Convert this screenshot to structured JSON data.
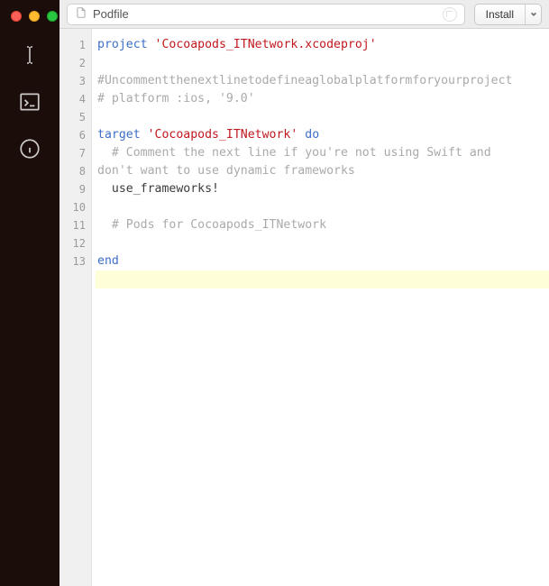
{
  "window": {
    "traffic_lights": [
      "close",
      "minimize",
      "maximize"
    ]
  },
  "sidebar": {
    "items": [
      {
        "id": "cursor-icon",
        "label": "Text Cursor"
      },
      {
        "id": "terminal-icon",
        "label": "Console"
      },
      {
        "id": "info-icon",
        "label": "Info"
      }
    ]
  },
  "toolbar": {
    "file_label": "Podfile",
    "install_label": "Install"
  },
  "editor": {
    "cursor_line": 13,
    "lines": [
      {
        "n": 1,
        "tokens": [
          {
            "t": "project ",
            "c": "tok-kw"
          },
          {
            "t": "'Cocoapods_ITNetwork.xcodeproj'",
            "c": "tok-str"
          }
        ]
      },
      {
        "n": 2,
        "tokens": []
      },
      {
        "n": 3,
        "tokens": [
          {
            "t": "# Uncomment the next line to define a global platform for your project",
            "c": "tok-com"
          }
        ]
      },
      {
        "n": 4,
        "tokens": [
          {
            "t": "# platform :ios, '9.0'",
            "c": "tok-com"
          }
        ]
      },
      {
        "n": 5,
        "tokens": []
      },
      {
        "n": 6,
        "tokens": [
          {
            "t": "target ",
            "c": "tok-kw"
          },
          {
            "t": "'Cocoapods_ITNetwork'",
            "c": "tok-str"
          },
          {
            "t": " do",
            "c": "tok-kw"
          }
        ]
      },
      {
        "n": 7,
        "tokens": [
          {
            "t": "  # Comment the next line if you're not using Swift and don't want to use dynamic frameworks",
            "c": "tok-com"
          }
        ]
      },
      {
        "n": 8,
        "tokens": [
          {
            "t": "  use_frameworks!",
            "c": "tok-id"
          }
        ]
      },
      {
        "n": 9,
        "tokens": []
      },
      {
        "n": 10,
        "tokens": [
          {
            "t": "  # Pods for Cocoapods_ITNetwork",
            "c": "tok-com"
          }
        ]
      },
      {
        "n": 11,
        "tokens": []
      },
      {
        "n": 12,
        "tokens": [
          {
            "t": "end",
            "c": "tok-kw"
          }
        ]
      },
      {
        "n": 13,
        "tokens": []
      }
    ]
  }
}
